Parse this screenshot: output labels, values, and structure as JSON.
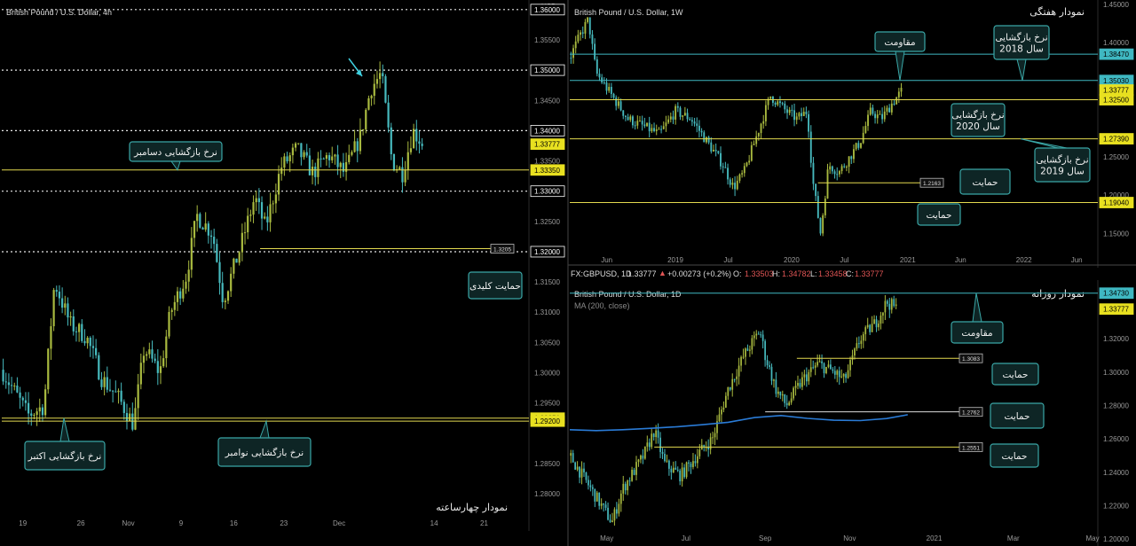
{
  "colors": {
    "background": "#000000",
    "bullish": "#a8b93f",
    "bearish": "#46b9bd",
    "yellow_line": "#e3d94f",
    "cyan_line": "#3fb8c2",
    "white_dotted": "#e8e8e8",
    "ma_line": "#2a7bd6",
    "callout_bg": "#0e2525",
    "callout_border": "#3aa7a7",
    "price_tag_bg": "#e8e020",
    "axis_text": "#9a9a9a"
  },
  "chart_data": [
    {
      "id": "h4",
      "type": "candlestick",
      "title": "British Pound / U.S. Dollar, 4h",
      "currency": "USD",
      "caption": "نمودار چهارساعته",
      "ylim": [
        1.2765,
        1.361
      ],
      "y_ticks": [
        "1.36000",
        "1.35500",
        "1.35000",
        "1.34500",
        "1.34000",
        "1.33777",
        "1.33500",
        "1.33350",
        "1.33000",
        "1.32500",
        "1.32000",
        "1.31500",
        "1.31000",
        "1.30500",
        "1.30000",
        "1.29500",
        "1.29250",
        "1.29200",
        "1.28500",
        "1.28000"
      ],
      "x_ticks": [
        {
          "label": "19",
          "i": 0.04
        },
        {
          "label": "26",
          "i": 0.15
        },
        {
          "label": "Nov",
          "i": 0.24
        },
        {
          "label": "9",
          "i": 0.34
        },
        {
          "label": "16",
          "i": 0.44
        },
        {
          "label": "23",
          "i": 0.535
        },
        {
          "label": "Dec",
          "i": 0.64
        },
        {
          "label": "14",
          "i": 0.82
        },
        {
          "label": "21",
          "i": 0.915
        }
      ],
      "points": [
        [
          0,
          1.3005
        ],
        [
          0.03,
          1.296
        ],
        [
          0.05,
          1.293
        ],
        [
          0.08,
          1.2945
        ],
        [
          0.1,
          1.315
        ],
        [
          0.13,
          1.308
        ],
        [
          0.16,
          1.306
        ],
        [
          0.19,
          1.299
        ],
        [
          0.22,
          1.296
        ],
        [
          0.25,
          1.2915
        ],
        [
          0.27,
          1.304
        ],
        [
          0.3,
          1.3
        ],
        [
          0.32,
          1.31
        ],
        [
          0.35,
          1.316
        ],
        [
          0.37,
          1.326
        ],
        [
          0.4,
          1.323
        ],
        [
          0.42,
          1.312
        ],
        [
          0.45,
          1.32
        ],
        [
          0.48,
          1.329
        ],
        [
          0.5,
          1.324
        ],
        [
          0.53,
          1.334
        ],
        [
          0.56,
          1.337
        ],
        [
          0.59,
          1.333
        ],
        [
          0.62,
          1.336
        ],
        [
          0.65,
          1.333
        ],
        [
          0.68,
          1.339
        ],
        [
          0.7,
          1.347
        ],
        [
          0.72,
          1.3495
        ],
        [
          0.74,
          1.335
        ],
        [
          0.76,
          1.333
        ],
        [
          0.78,
          1.34
        ],
        [
          0.8,
          1.3377
        ]
      ],
      "series": [
        {
          "name": "GBPUSD",
          "last": 1.33777
        }
      ],
      "annotations": [
        {
          "label": "نرخ بازگشایی دسامبر",
          "level": 1.3335
        },
        {
          "label": "حمایت کلیدی",
          "level": 1.3205,
          "tag": "1.3205"
        },
        {
          "label": "نرخ بازگشایی اکتبر",
          "level": 1.2925
        },
        {
          "label": "نرخ بازگشایی نوامبر",
          "level": 1.292
        }
      ],
      "dotted_levels": [
        1.36,
        1.35,
        1.34,
        1.33,
        1.32
      ],
      "price_tags": [
        {
          "value": "1.36000",
          "style": "plain"
        },
        {
          "value": "1.35000",
          "style": "plain"
        },
        {
          "value": "1.34000",
          "style": "plain"
        },
        {
          "value": "1.33777",
          "style": "yellow"
        },
        {
          "value": "1.33350",
          "style": "yellow"
        },
        {
          "value": "1.33000",
          "style": "plain"
        },
        {
          "value": "1.32000",
          "style": "plain"
        },
        {
          "value": "1.29250",
          "style": "yellow"
        },
        {
          "value": "1.29200",
          "style": "yellow"
        }
      ]
    },
    {
      "id": "w1",
      "type": "candlestick",
      "title": "British Pound / U.S. Dollar, 1W",
      "caption": "نمودار هفتگی",
      "ylim": [
        1.126,
        1.451
      ],
      "y_ticks": [
        "1.45000",
        "1.40000",
        "1.38470",
        "1.35030",
        "1.33777",
        "1.32500",
        "1.27390",
        "1.25000",
        "1.20000",
        "1.19040",
        "1.15000"
      ],
      "x_ticks": [
        {
          "label": "Jun",
          "i": 0.07
        },
        {
          "label": "2019",
          "i": 0.2
        },
        {
          "label": "Jul",
          "i": 0.3
        },
        {
          "label": "2020",
          "i": 0.42
        },
        {
          "label": "Jul",
          "i": 0.52
        },
        {
          "label": "2021",
          "i": 0.64
        },
        {
          "label": "Jun",
          "i": 0.74
        },
        {
          "label": "2022",
          "i": 0.86
        },
        {
          "label": "Jun",
          "i": 0.96
        }
      ],
      "points": [
        [
          0,
          1.38
        ],
        [
          0.02,
          1.41
        ],
        [
          0.035,
          1.43
        ],
        [
          0.05,
          1.36
        ],
        [
          0.08,
          1.33
        ],
        [
          0.11,
          1.3
        ],
        [
          0.14,
          1.29
        ],
        [
          0.17,
          1.28
        ],
        [
          0.2,
          1.31
        ],
        [
          0.23,
          1.3
        ],
        [
          0.26,
          1.27
        ],
        [
          0.29,
          1.24
        ],
        [
          0.31,
          1.21
        ],
        [
          0.33,
          1.23
        ],
        [
          0.36,
          1.29
        ],
        [
          0.38,
          1.33
        ],
        [
          0.41,
          1.31
        ],
        [
          0.43,
          1.3
        ],
        [
          0.45,
          1.31
        ],
        [
          0.46,
          1.22
        ],
        [
          0.475,
          1.15
        ],
        [
          0.49,
          1.24
        ],
        [
          0.51,
          1.23
        ],
        [
          0.53,
          1.25
        ],
        [
          0.55,
          1.27
        ],
        [
          0.57,
          1.31
        ],
        [
          0.59,
          1.3
        ],
        [
          0.61,
          1.32
        ],
        [
          0.63,
          1.3378
        ]
      ],
      "series": [
        {
          "name": "GBPUSD",
          "last": 1.33777
        }
      ],
      "annotations": [
        {
          "label": "مقاومت",
          "level": 1.3503
        },
        {
          "label": "نرخ بازگشایی\nسال 2018",
          "level": 1.3847
        },
        {
          "label": "نرخ بازگشایی\nسال 2020",
          "level": 1.325
        },
        {
          "label": "نرخ بازگشایی\nسال 2019",
          "level": 1.2739
        },
        {
          "label": "حمایت",
          "level": 1.2163,
          "tag": "1.2163"
        },
        {
          "label": "حمایت",
          "level": 1.1904
        }
      ],
      "price_tags": [
        {
          "value": "1.38470",
          "style": "cyan"
        },
        {
          "value": "1.35030",
          "style": "cyan"
        },
        {
          "value": "1.33777",
          "style": "yellow"
        },
        {
          "value": "1.32500",
          "style": "yellow"
        },
        {
          "value": "1.27390",
          "style": "yellow"
        },
        {
          "value": "1.19040",
          "style": "yellow"
        }
      ]
    },
    {
      "id": "d1",
      "type": "candlestick",
      "title": "British Pound / U.S. Dollar, 1D",
      "caption": "نمودار روزانه",
      "ma_label": "MA (200, close)",
      "currency": "USD",
      "ylim": [
        1.198,
        1.353
      ],
      "y_ticks": [
        "1.34730",
        "1.33777",
        "1.32000",
        "1.30000",
        "1.28000",
        "1.26000",
        "1.24000",
        "1.22000",
        "1.20000"
      ],
      "x_ticks": [
        {
          "label": "May",
          "i": 0.07
        },
        {
          "label": "Jul",
          "i": 0.22
        },
        {
          "label": "Sep",
          "i": 0.37
        },
        {
          "label": "Nov",
          "i": 0.53
        },
        {
          "label": "2021",
          "i": 0.69
        },
        {
          "label": "Mar",
          "i": 0.84
        },
        {
          "label": "May",
          "i": 0.99
        }
      ],
      "points": [
        [
          0,
          1.25
        ],
        [
          0.03,
          1.235
        ],
        [
          0.06,
          1.22
        ],
        [
          0.08,
          1.21
        ],
        [
          0.1,
          1.23
        ],
        [
          0.12,
          1.24
        ],
        [
          0.14,
          1.25
        ],
        [
          0.16,
          1.265
        ],
        [
          0.18,
          1.245
        ],
        [
          0.21,
          1.238
        ],
        [
          0.24,
          1.25
        ],
        [
          0.27,
          1.26
        ],
        [
          0.3,
          1.29
        ],
        [
          0.33,
          1.31
        ],
        [
          0.36,
          1.325
        ],
        [
          0.37,
          1.31
        ],
        [
          0.39,
          1.29
        ],
        [
          0.41,
          1.28
        ],
        [
          0.44,
          1.295
        ],
        [
          0.47,
          1.305
        ],
        [
          0.5,
          1.3
        ],
        [
          0.52,
          1.295
        ],
        [
          0.55,
          1.32
        ],
        [
          0.58,
          1.33
        ],
        [
          0.6,
          1.342
        ],
        [
          0.62,
          1.3378
        ]
      ],
      "ma": [
        [
          0,
          1.2655
        ],
        [
          0.05,
          1.265
        ],
        [
          0.1,
          1.2655
        ],
        [
          0.15,
          1.2663
        ],
        [
          0.2,
          1.2672
        ],
        [
          0.25,
          1.2685
        ],
        [
          0.3,
          1.27
        ],
        [
          0.35,
          1.2728
        ],
        [
          0.4,
          1.274
        ],
        [
          0.45,
          1.2723
        ],
        [
          0.5,
          1.2712
        ],
        [
          0.55,
          1.271
        ],
        [
          0.6,
          1.2722
        ],
        [
          0.64,
          1.2745
        ]
      ],
      "series": [
        {
          "name": "GBPUSD",
          "last": 1.33777
        },
        {
          "name": "MA (200, close)"
        }
      ],
      "annotations": [
        {
          "label": "مقاومت",
          "level": 1.3473
        },
        {
          "label": "حمایت",
          "level": 1.3083,
          "tag": "1.3083"
        },
        {
          "label": "حمایت",
          "level": 1.2762,
          "tag": "1.2762"
        },
        {
          "label": "حمایت",
          "level": 1.2551,
          "tag": "1.2551"
        }
      ],
      "price_tags": [
        {
          "value": "1.34730",
          "style": "cyan"
        },
        {
          "value": "1.33777",
          "style": "yellow"
        }
      ]
    }
  ],
  "ohlc_header": {
    "symbol": "FX:GBPUSD, 1D",
    "last": "1.33777",
    "change": "+0.00273 (+0.2%)",
    "o_label": "O:",
    "o": "1.33503",
    "h_label": "H:",
    "h": "1.34782",
    "l_label": "L:",
    "l": "1.33458",
    "c_label": "C:",
    "c": "1.33777"
  }
}
